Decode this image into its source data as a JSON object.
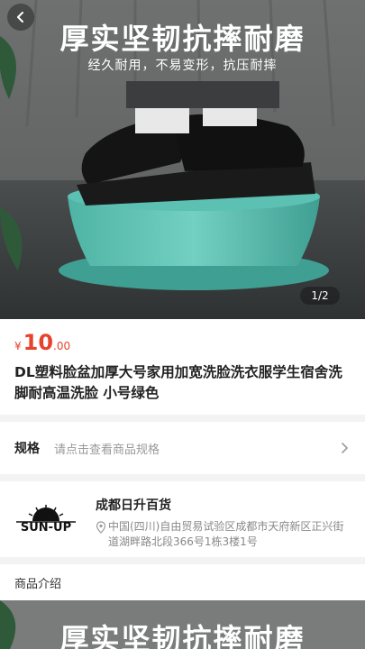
{
  "hero": {
    "headline": "厚实坚韧抗摔耐磨",
    "subline": "经久耐用，不易变形，抗压耐摔",
    "pager": "1/2",
    "back_icon": "chevron-left-icon"
  },
  "product": {
    "currency": "¥",
    "price_int": "10",
    "price_dec": ".00",
    "title": "DL塑料脸盆加厚大号家用加宽洗脸洗衣服学生宿舍洗脚耐高温洗脸 小号绿色",
    "price_color": "#e8412c"
  },
  "spec": {
    "label": "规格",
    "hint": "请点击查看商品规格"
  },
  "shop": {
    "name": "成都日升百货",
    "logo_text": "SUN-UP",
    "address": "中国(四川)自由贸易试验区成都市天府新区正兴街道湖畔路北段366号1栋3楼1号"
  },
  "section": {
    "intro": "商品介绍"
  },
  "detail": {
    "headline": "厚实坚韧抗摔耐磨"
  }
}
